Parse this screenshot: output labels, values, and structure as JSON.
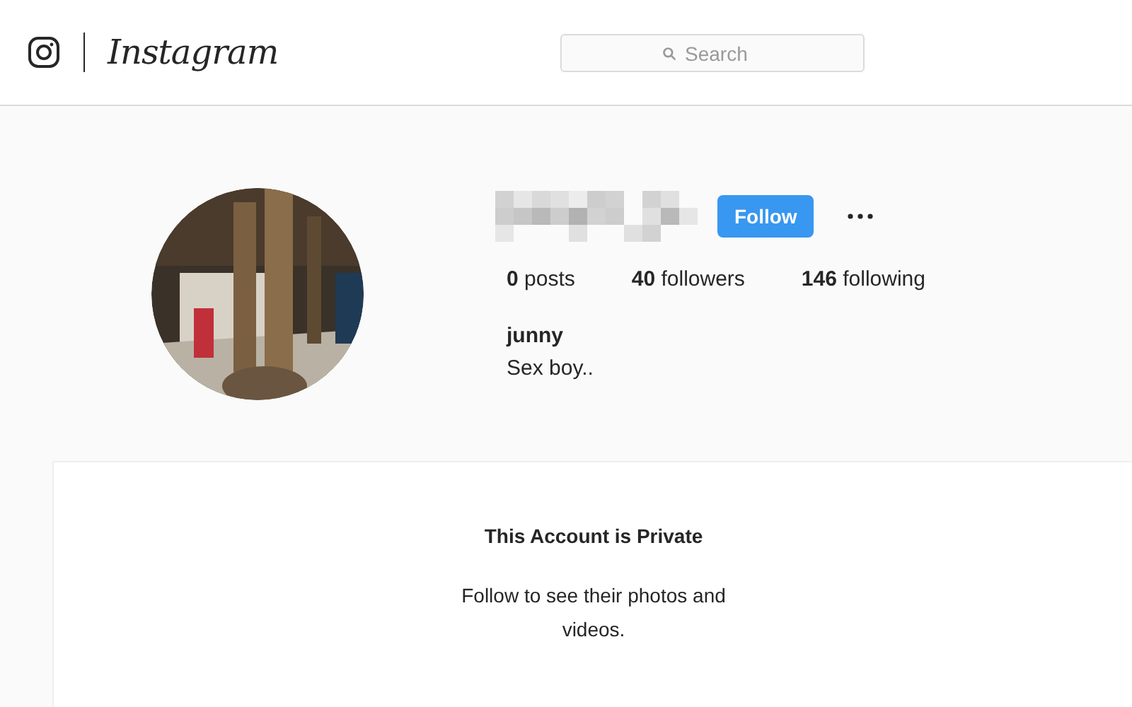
{
  "header": {
    "logo_text": "Instagram",
    "search": {
      "placeholder": "Search"
    }
  },
  "profile": {
    "follow_button": "Follow",
    "stats": [
      "**0** posts",
      "**40** followers",
      "**146** following"
    ],
    "display_name": "junny",
    "bio": "Sex boy.."
  },
  "private_notice": {
    "title": "This Account is Private",
    "message": "Follow to see their photos and videos."
  }
}
